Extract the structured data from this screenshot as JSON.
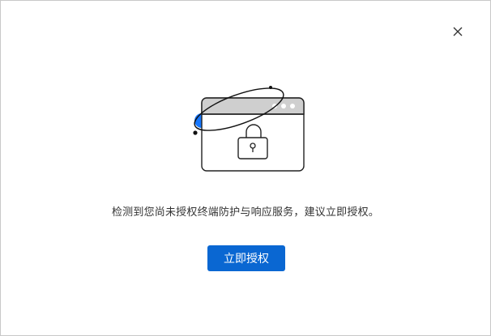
{
  "dialog": {
    "close_icon": "close-icon",
    "illustration_icon": "browser-lock-illustration",
    "message": "检测到您尚未授权终端防护与响应服务，建议立即授权。",
    "authorize_button_label": "立即授权"
  },
  "colors": {
    "accent": "#0a67d2",
    "illustration_blue": "#1677ff",
    "window_header": "#cfcfcf",
    "text": "#333333",
    "border": "#c8c8c8"
  }
}
